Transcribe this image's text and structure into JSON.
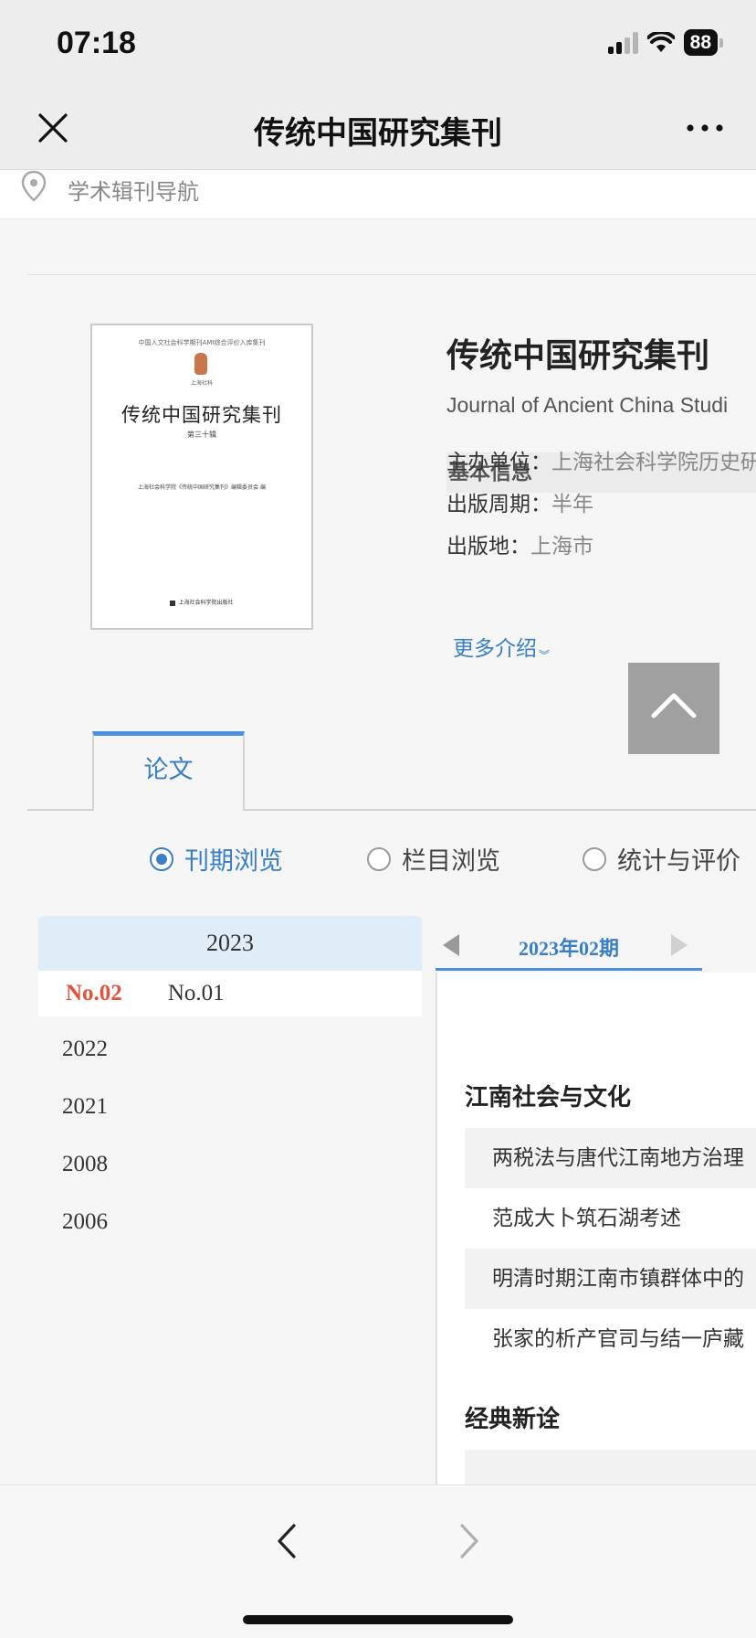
{
  "status": {
    "time": "07:18",
    "battery": "88"
  },
  "nav": {
    "title": "传统中国研究集刊"
  },
  "strip": {
    "label": "学术辑刊导航"
  },
  "journal": {
    "title": "传统中国研究集刊",
    "english_title": "Journal of Ancient China Studi",
    "info_header": "基本信息",
    "rows": [
      {
        "label": "主办单位：",
        "value": "上海社会科学院历史研"
      },
      {
        "label": "出版周期：",
        "value": "半年"
      },
      {
        "label": "出版地：",
        "value": "上海市"
      }
    ],
    "more_label": "更多介绍"
  },
  "cover": {
    "top_text": "中国人文社会科学期刊AMI综合评价入库集刊",
    "seal_caption": "上海社科",
    "title": "传统中国研究集刊",
    "volume": "第三十辑",
    "editor": "上海社会科学院《传统中国研究集刊》编辑委员会 编",
    "publisher": "上海社会科学院出版社"
  },
  "tabs": {
    "paper": "论文"
  },
  "browse": {
    "options": [
      "刊期浏览",
      "栏目浏览",
      "统计与评价"
    ],
    "selected": 0
  },
  "years": {
    "current": "2023",
    "issues": {
      "current": "No.02",
      "other": "No.01"
    },
    "list": [
      "2022",
      "2021",
      "2008",
      "2006"
    ]
  },
  "issue": {
    "label": "2023年02期"
  },
  "toc": {
    "sections": [
      {
        "title": "江南社会与文化",
        "items": [
          "两税法与唐代江南地方治理",
          "范成大卜筑石湖考述",
          "明清时期江南市镇群体中的",
          "张家的析产官司与结一庐藏"
        ]
      },
      {
        "title": "经典新诠",
        "items": []
      }
    ]
  },
  "colors": {
    "accent": "#3a7fc4",
    "current_issue": "#e0533c",
    "year_highlight": "#deedf8"
  }
}
